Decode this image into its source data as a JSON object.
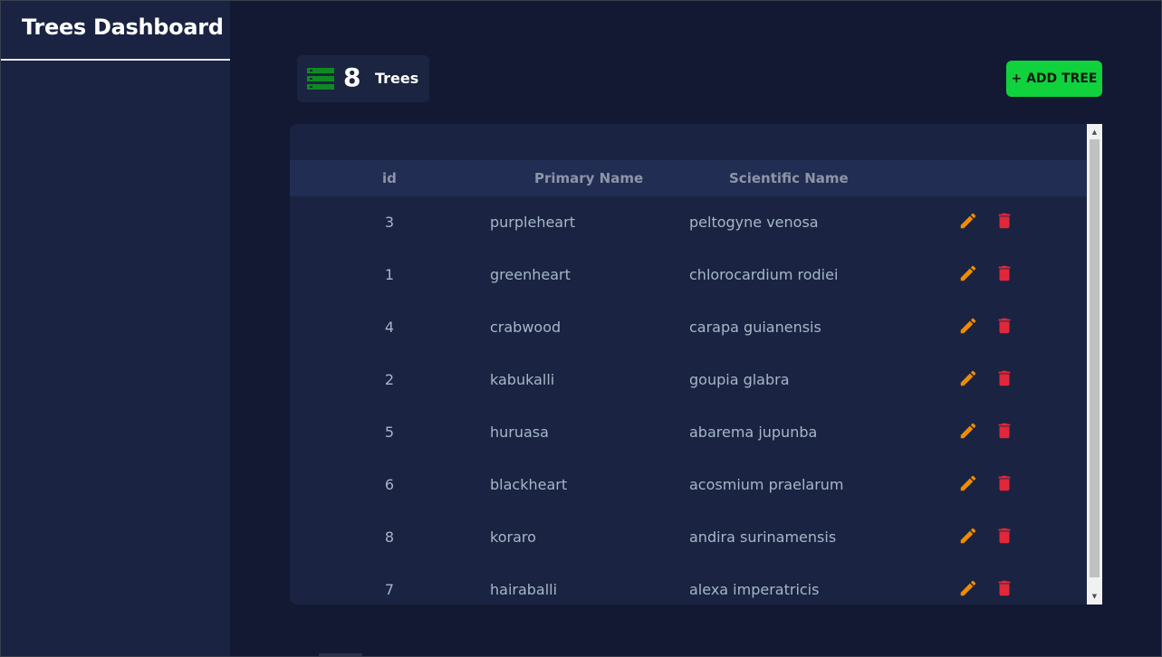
{
  "sidebar": {
    "title": "Trees Dashboard"
  },
  "counter": {
    "count": "8",
    "label": "Trees",
    "icon": "server-stack-icon",
    "icon_color": "#0e8a22"
  },
  "toolbar": {
    "add_label": "+ ADD TREE",
    "accent": "#10d23c"
  },
  "table": {
    "columns": [
      "id",
      "Primary Name",
      "Scientific Name"
    ],
    "rows": [
      {
        "id": "3",
        "primary": "purpleheart",
        "scientific": "peltogyne venosa"
      },
      {
        "id": "1",
        "primary": "greenheart",
        "scientific": "chlorocardium rodiei"
      },
      {
        "id": "4",
        "primary": "crabwood",
        "scientific": "carapa guianensis"
      },
      {
        "id": "2",
        "primary": "kabukalli",
        "scientific": "goupia glabra"
      },
      {
        "id": "5",
        "primary": "huruasa",
        "scientific": "abarema jupunba"
      },
      {
        "id": "6",
        "primary": "blackheart",
        "scientific": "acosmium praelarum"
      },
      {
        "id": "8",
        "primary": "koraro",
        "scientific": "andira surinamensis"
      },
      {
        "id": "7",
        "primary": "hairaballi",
        "scientific": "alexa imperatricis"
      }
    ],
    "edit_icon": "pencil-icon",
    "delete_icon": "trash-icon",
    "edit_color": "#f08c00",
    "delete_color": "#e0283a"
  }
}
